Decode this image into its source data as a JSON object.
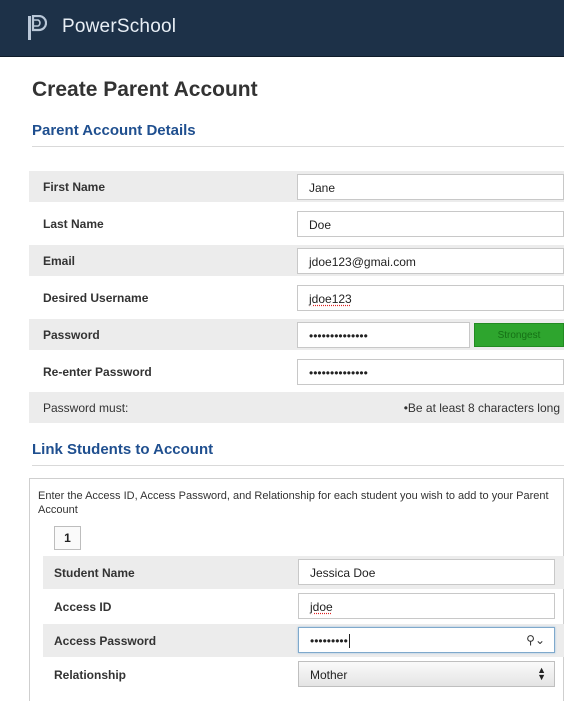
{
  "header": {
    "brand": "PowerSchool"
  },
  "page": {
    "title": "Create Parent Account"
  },
  "parent_section": {
    "title": "Parent Account Details",
    "fields": {
      "first_name": {
        "label": "First Name",
        "value": "Jane"
      },
      "last_name": {
        "label": "Last Name",
        "value": "Doe"
      },
      "email": {
        "label": "Email",
        "value": "jdoe123@gmai.com"
      },
      "username": {
        "label": "Desired Username",
        "value": "jdoe123"
      },
      "password": {
        "label": "Password",
        "value": "••••••••••••••",
        "strength": "Strongest"
      },
      "reenter": {
        "label": "Re-enter Password",
        "value": "••••••••••••••"
      }
    },
    "rules": {
      "label": "Password must:",
      "text": "•Be at least 8 characters long"
    }
  },
  "link_section": {
    "title": "Link Students to Account",
    "instructions": "Enter the Access ID, Access Password, and Relationship for each student you wish to add to your Parent Account",
    "student_number": "1",
    "fields": {
      "student_name": {
        "label": "Student Name",
        "value": "Jessica Doe"
      },
      "access_id": {
        "label": "Access ID",
        "value": "jdoe"
      },
      "access_password": {
        "label": "Access Password",
        "value": "•••••••••"
      },
      "relationship": {
        "label": "Relationship",
        "value": "Mother"
      }
    }
  },
  "icons": {
    "logo": "powerschool-logo-icon",
    "reveal": "key-reveal-icon",
    "select": "select-arrows-icon"
  },
  "colors": {
    "header": "#1d3148",
    "section_title": "#1f4f8f",
    "strength": "#2ea52e",
    "row_shade": "#ececec"
  }
}
